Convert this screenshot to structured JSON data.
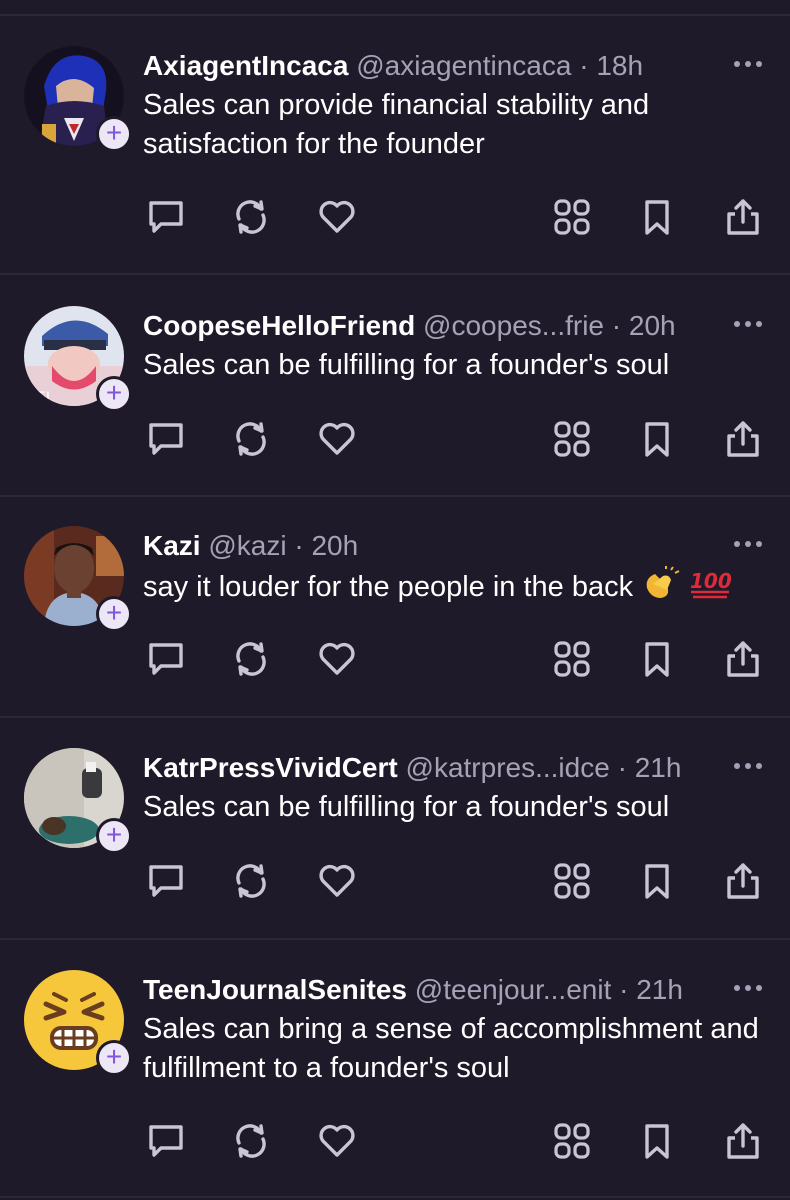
{
  "posts": [
    {
      "name": "AxiagentIncaca",
      "handle": "@axiagentincaca",
      "separator": "·",
      "time": "18h",
      "text": "Sales can provide financial stability and satisfaction for the founder",
      "avatar": "avatar-blue-haired-character"
    },
    {
      "name": "CoopeseHelloFriend",
      "handle": "@coopes...frie",
      "separator": "·",
      "time": "20h",
      "text": "Sales can be fulfilling for a founder's soul",
      "avatar": "avatar-cartoon-character-with-hat"
    },
    {
      "name": "Kazi",
      "handle": "@kazi",
      "separator": "·",
      "time": "20h",
      "text": "say it louder for the people in the back",
      "emojis": [
        "clapping-hands",
        "hundred-points"
      ],
      "avatar": "avatar-man-portrait"
    },
    {
      "name": "KatrPressVividCert",
      "handle": "@katrpres...idce",
      "separator": "·",
      "time": "21h",
      "text": "Sales can be fulfilling for a founder's soul",
      "avatar": "avatar-room-with-object"
    },
    {
      "name": "TeenJournalSenites",
      "handle": "@teenjour...enit",
      "separator": "·",
      "time": "21h",
      "text": "Sales can bring a sense of accomplishment and fulfillment to a founder's soul",
      "avatar": "avatar-grimacing-emoji"
    }
  ],
  "follow_badge": "+",
  "action_icons": [
    "reply-icon",
    "repost-icon",
    "like-icon",
    "feeds-icon",
    "bookmark-icon",
    "share-icon"
  ],
  "colors": {
    "background": "#1f1a29",
    "divider": "#2d2839",
    "muted_text": "#a7a1b7",
    "icon": "#c9c4d6",
    "badge_bg": "#ece6f7",
    "badge_plus": "#7f56d9"
  }
}
